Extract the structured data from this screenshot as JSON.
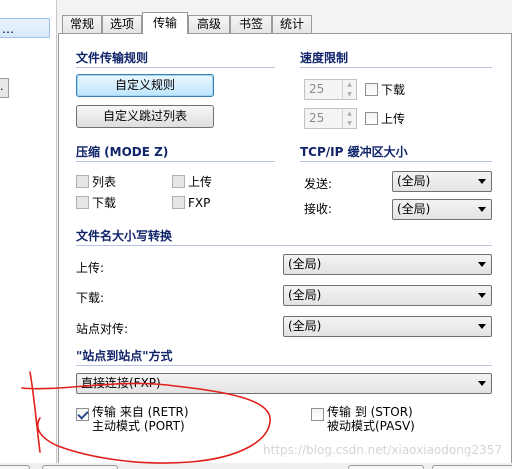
{
  "left_pane": {
    "selected_item": "…",
    "small_button": "."
  },
  "tabs": [
    {
      "label": "常规"
    },
    {
      "label": "选项"
    },
    {
      "label": "传输"
    },
    {
      "label": "高级"
    },
    {
      "label": "书签"
    },
    {
      "label": "统计"
    }
  ],
  "file_transfer_rules": {
    "title": "文件传输规则",
    "custom_rules_button": "自定义规则",
    "custom_skip_list_button": "自定义跳过列表"
  },
  "speed_limit": {
    "title": "速度限制",
    "download_value": "25",
    "download_label": "下载",
    "upload_value": "25",
    "upload_label": "上传"
  },
  "compression": {
    "title": "压缩 (MODE Z)",
    "list_label": "列表",
    "upload_label": "上传",
    "download_label": "下载",
    "fxp_label": "FXP"
  },
  "tcp_buffer": {
    "title": "TCP/IP 缓冲区大小",
    "send_label": "发送:",
    "send_value": "(全局)",
    "receive_label": "接收:",
    "receive_value": "(全局)"
  },
  "filename_case": {
    "title": "文件名大小写转换",
    "upload_label": "上传:",
    "upload_value": "(全局)",
    "download_label": "下载:",
    "download_value": "(全局)",
    "site_to_site_label": "站点对传:",
    "site_to_site_value": "(全局)"
  },
  "site_to_site_mode": {
    "title": "\"站点到站点\"方式",
    "mode_value": "直接连接(FXP)",
    "retr_line1": "传输 来自 (RETR)",
    "retr_line2": "主动模式 (PORT)",
    "stor_line1": "传输 到 (STOR)",
    "stor_line2": "被动模式(PASV)"
  },
  "colors": {
    "section_title": "#10246a",
    "annotation_red": "#e0201a"
  },
  "watermark": "https://blog.csdn.net/xiaoxiaodong2357"
}
